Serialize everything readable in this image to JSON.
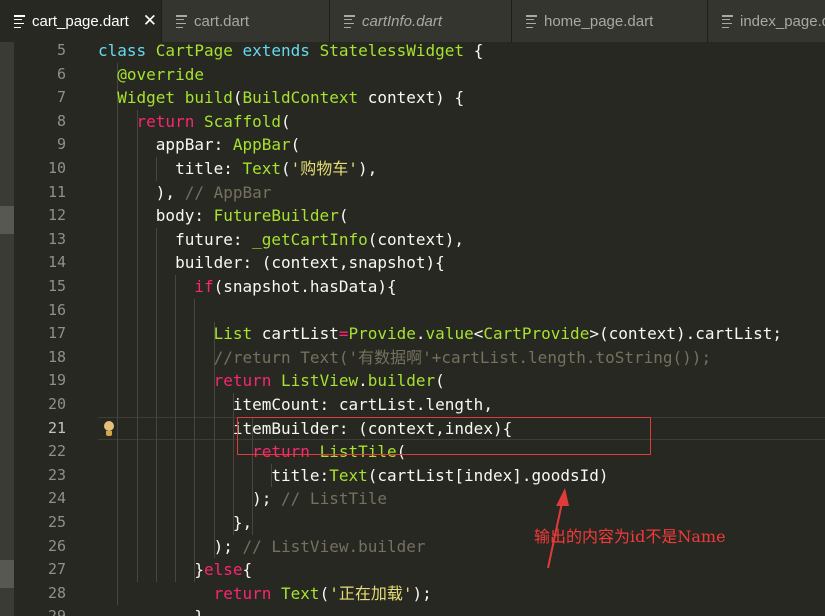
{
  "tabs": [
    {
      "label": "cart_page.dart",
      "active": true,
      "italic": false,
      "close": "✕"
    },
    {
      "label": "cart.dart",
      "active": false,
      "italic": false
    },
    {
      "label": "cartInfo.dart",
      "active": false,
      "italic": true
    },
    {
      "label": "home_page.dart",
      "active": false,
      "italic": false
    },
    {
      "label": "index_page.d",
      "active": false,
      "italic": false
    }
  ],
  "editor": {
    "current_line": 21,
    "lines": [
      {
        "n": "5",
        "tokens": [
          [
            "kw",
            "class "
          ],
          [
            "ty",
            "CartPage "
          ],
          [
            "kw",
            "extends "
          ],
          [
            "ty",
            "StatelessWidget "
          ],
          [
            "pl",
            "{"
          ]
        ]
      },
      {
        "n": "6",
        "tokens": [
          [
            "fn",
            "  @override"
          ]
        ]
      },
      {
        "n": "7",
        "tokens": [
          [
            "ty",
            "  Widget "
          ],
          [
            "fn",
            "build"
          ],
          [
            "pl",
            "("
          ],
          [
            "ty",
            "BuildContext"
          ],
          [
            "pl",
            " context) {"
          ]
        ]
      },
      {
        "n": "8",
        "tokens": [
          [
            "kwr",
            "    return "
          ],
          [
            "ty",
            "Scaffold"
          ],
          [
            "pl",
            "("
          ]
        ]
      },
      {
        "n": "9",
        "tokens": [
          [
            "pl",
            "      appBar: "
          ],
          [
            "ty",
            "AppBar"
          ],
          [
            "pl",
            "("
          ]
        ]
      },
      {
        "n": "10",
        "tokens": [
          [
            "pl",
            "        title: "
          ],
          [
            "ty",
            "Text"
          ],
          [
            "pl",
            "("
          ],
          [
            "str",
            "'购物车'"
          ],
          [
            "pl",
            "),"
          ]
        ]
      },
      {
        "n": "11",
        "tokens": [
          [
            "pl",
            "      ), "
          ],
          [
            "cm",
            "// AppBar"
          ]
        ]
      },
      {
        "n": "12",
        "tokens": [
          [
            "pl",
            "      body: "
          ],
          [
            "ty",
            "FutureBuilder"
          ],
          [
            "pl",
            "("
          ]
        ]
      },
      {
        "n": "13",
        "tokens": [
          [
            "pl",
            "        future: "
          ],
          [
            "fn",
            "_getCartInfo"
          ],
          [
            "pl",
            "(context),"
          ]
        ]
      },
      {
        "n": "14",
        "tokens": [
          [
            "pl",
            "        builder: (context,snapshot){"
          ]
        ]
      },
      {
        "n": "15",
        "tokens": [
          [
            "kwr",
            "          if"
          ],
          [
            "pl",
            "(snapshot.hasData){"
          ]
        ]
      },
      {
        "n": "16",
        "tokens": []
      },
      {
        "n": "17",
        "tokens": [
          [
            "ty",
            "            List "
          ],
          [
            "pl",
            "cartList"
          ],
          [
            "kwr",
            "="
          ],
          [
            "ty",
            "Provide"
          ],
          [
            "pl",
            "."
          ],
          [
            "fn",
            "value"
          ],
          [
            "pl",
            "<"
          ],
          [
            "ty",
            "CartProvide"
          ],
          [
            "pl",
            ">(context).cartList;"
          ]
        ]
      },
      {
        "n": "18",
        "tokens": [
          [
            "cm",
            "            //return Text('有数据啊'+cartList.length.toString());"
          ]
        ]
      },
      {
        "n": "19",
        "tokens": [
          [
            "kwr",
            "            return "
          ],
          [
            "ty",
            "ListView"
          ],
          [
            "pl",
            "."
          ],
          [
            "fn",
            "builder"
          ],
          [
            "pl",
            "("
          ]
        ]
      },
      {
        "n": "20",
        "tokens": [
          [
            "pl",
            "              itemCount: cartList.length,"
          ]
        ]
      },
      {
        "n": "21",
        "tokens": [
          [
            "pl",
            "              itemBuilder: (context,index){"
          ]
        ]
      },
      {
        "n": "22",
        "tokens": [
          [
            "kwr",
            "                return "
          ],
          [
            "ty",
            "ListTile"
          ],
          [
            "pl",
            "("
          ]
        ]
      },
      {
        "n": "23",
        "tokens": [
          [
            "pl",
            "                  title:"
          ],
          [
            "ty",
            "Text"
          ],
          [
            "pl",
            "(cartList[index].goodsId)"
          ]
        ]
      },
      {
        "n": "24",
        "tokens": [
          [
            "pl",
            "                ); "
          ],
          [
            "cm",
            "// ListTile"
          ]
        ]
      },
      {
        "n": "25",
        "tokens": [
          [
            "pl",
            "              },"
          ]
        ]
      },
      {
        "n": "26",
        "tokens": [
          [
            "pl",
            "            ); "
          ],
          [
            "cm",
            "// ListView.builder"
          ]
        ]
      },
      {
        "n": "27",
        "tokens": [
          [
            "pl",
            "          }"
          ],
          [
            "kwr",
            "else"
          ],
          [
            "pl",
            "{"
          ]
        ]
      },
      {
        "n": "28",
        "tokens": [
          [
            "kwr",
            "            return "
          ],
          [
            "ty",
            "Text"
          ],
          [
            "pl",
            "("
          ],
          [
            "str",
            "'正在加载'"
          ],
          [
            "pl",
            ");"
          ]
        ]
      },
      {
        "n": "29",
        "tokens": [
          [
            "pl",
            "          }"
          ]
        ]
      }
    ]
  },
  "annotation": {
    "text": "输出的内容为id不是Name",
    "color": "#f23a3a"
  },
  "colors": {
    "background": "#272822",
    "keyword": "#66d9ef",
    "control": "#f92672",
    "type": "#a6e22e",
    "string": "#e6db74",
    "comment": "#75715e",
    "text": "#f8f8f2"
  },
  "icons": {
    "tab": "file-lines-icon",
    "close": "close-icon",
    "hint": "lightbulb-icon"
  }
}
